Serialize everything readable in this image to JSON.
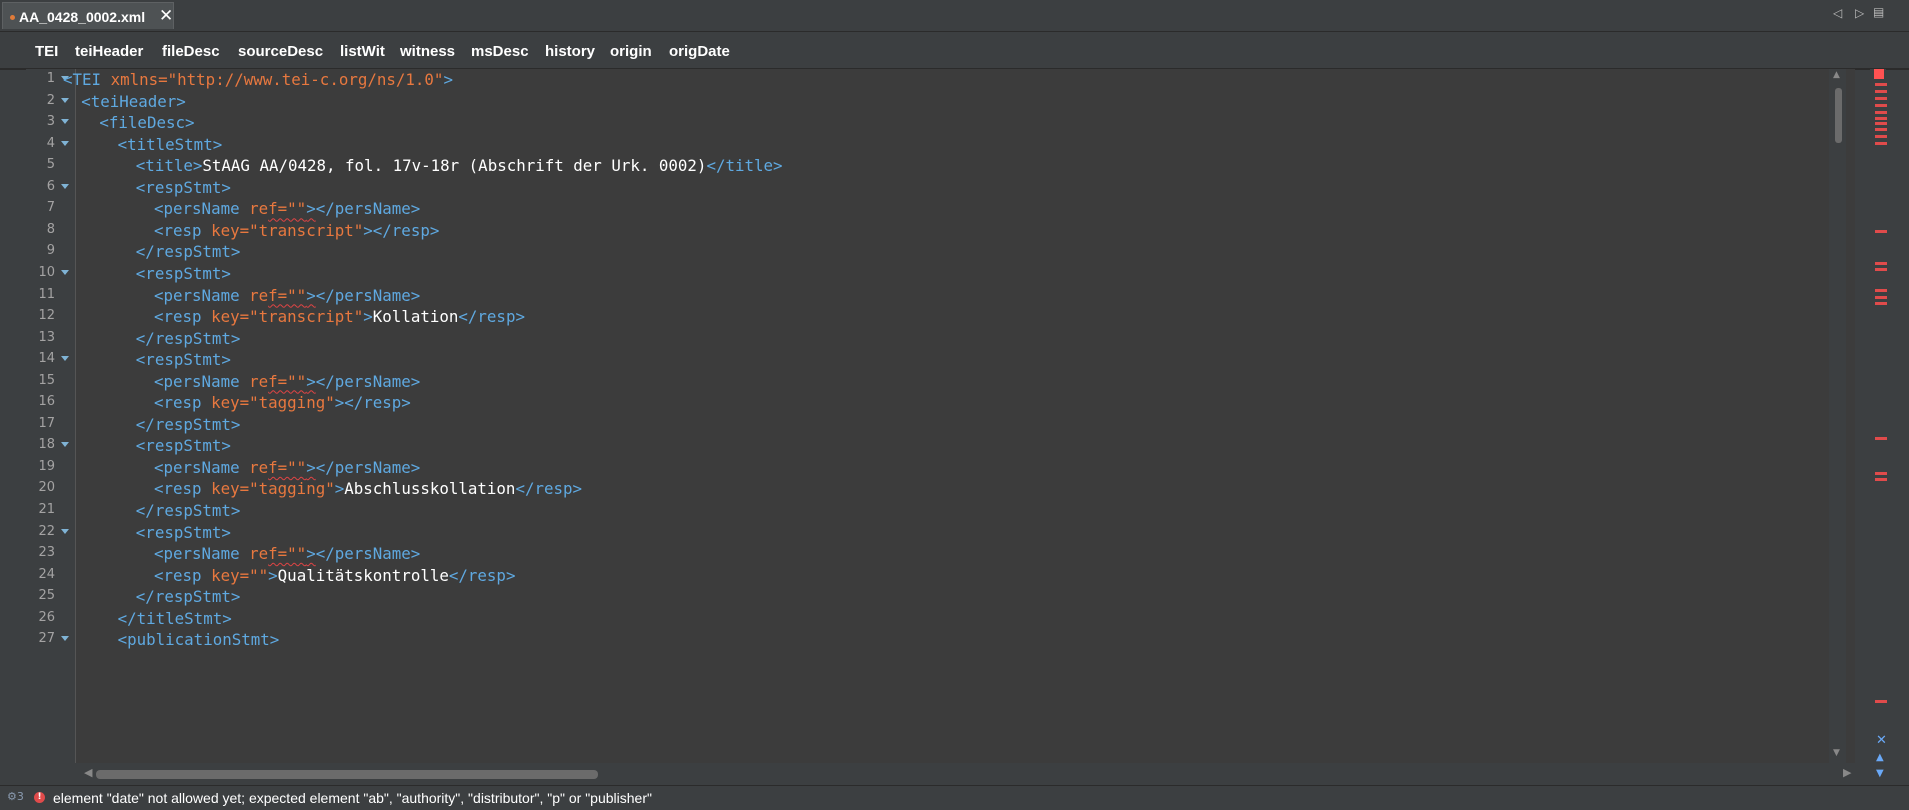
{
  "tab": {
    "title": "AA_0428_0002.xml",
    "close": "✕",
    "modified": true
  },
  "tab_nav": {
    "prev": "◁",
    "next": "▷",
    "menu": "▤"
  },
  "breadcrumb": [
    "TEI",
    "teiHeader",
    "fileDesc",
    "sourceDesc",
    "listWit",
    "witness",
    "msDesc",
    "history",
    "origin",
    "origDate"
  ],
  "editor": {
    "lines": [
      {
        "n": "1",
        "fold": true,
        "indent": 0,
        "tokens": [
          {
            "c": "tag",
            "t": "<TEI "
          },
          {
            "c": "attr",
            "t": "xmlns="
          },
          {
            "c": "val",
            "t": "\"http://www.tei-c.org/ns/1.0\""
          },
          {
            "c": "tag",
            "t": ">"
          }
        ]
      },
      {
        "n": "2",
        "fold": true,
        "indent": 1,
        "tokens": [
          {
            "c": "tag",
            "t": "<teiHeader>"
          }
        ]
      },
      {
        "n": "3",
        "fold": true,
        "indent": 2,
        "tokens": [
          {
            "c": "tag",
            "t": "<fileDesc>"
          }
        ]
      },
      {
        "n": "4",
        "fold": true,
        "indent": 3,
        "tokens": [
          {
            "c": "tag",
            "t": "<titleStmt>"
          }
        ]
      },
      {
        "n": "5",
        "fold": false,
        "indent": 4,
        "tokens": [
          {
            "c": "tag",
            "t": "<title>"
          },
          {
            "c": "text",
            "t": "StAAG AA/0428, fol. 17v-18r (Abschrift der Urk. 0002)"
          },
          {
            "c": "tag",
            "t": "</title>"
          }
        ]
      },
      {
        "n": "6",
        "fold": true,
        "indent": 4,
        "tokens": [
          {
            "c": "tag",
            "t": "<respStmt>"
          }
        ]
      },
      {
        "n": "7",
        "fold": false,
        "indent": 5,
        "tokens": [
          {
            "c": "tag",
            "t": "<persName "
          },
          {
            "c": "attr",
            "t": "re"
          },
          {
            "c": "attr sq",
            "t": "f=\"\""
          },
          {
            "c": "tag sq",
            "t": ">"
          },
          {
            "c": "tag",
            "t": "</persName>"
          }
        ]
      },
      {
        "n": "8",
        "fold": false,
        "indent": 5,
        "tokens": [
          {
            "c": "tag",
            "t": "<resp "
          },
          {
            "c": "attr",
            "t": "key="
          },
          {
            "c": "val",
            "t": "\"transcript\""
          },
          {
            "c": "tag",
            "t": "></resp>"
          }
        ]
      },
      {
        "n": "9",
        "fold": false,
        "indent": 4,
        "tokens": [
          {
            "c": "tag",
            "t": "</respStmt>"
          }
        ]
      },
      {
        "n": "10",
        "fold": true,
        "indent": 4,
        "tokens": [
          {
            "c": "tag",
            "t": "<respStmt>"
          }
        ]
      },
      {
        "n": "11",
        "fold": false,
        "indent": 5,
        "tokens": [
          {
            "c": "tag",
            "t": "<persName "
          },
          {
            "c": "attr",
            "t": "re"
          },
          {
            "c": "attr sq",
            "t": "f=\"\""
          },
          {
            "c": "tag sq",
            "t": ">"
          },
          {
            "c": "tag",
            "t": "</persName>"
          }
        ]
      },
      {
        "n": "12",
        "fold": false,
        "indent": 5,
        "tokens": [
          {
            "c": "tag",
            "t": "<resp "
          },
          {
            "c": "attr",
            "t": "key="
          },
          {
            "c": "val",
            "t": "\"transcript\""
          },
          {
            "c": "tag",
            "t": ">"
          },
          {
            "c": "text",
            "t": "Kollation"
          },
          {
            "c": "tag",
            "t": "</resp>"
          }
        ]
      },
      {
        "n": "13",
        "fold": false,
        "indent": 4,
        "tokens": [
          {
            "c": "tag",
            "t": "</respStmt>"
          }
        ]
      },
      {
        "n": "14",
        "fold": true,
        "indent": 4,
        "tokens": [
          {
            "c": "tag",
            "t": "<respStmt>"
          }
        ]
      },
      {
        "n": "15",
        "fold": false,
        "indent": 5,
        "tokens": [
          {
            "c": "tag",
            "t": "<persName "
          },
          {
            "c": "attr",
            "t": "re"
          },
          {
            "c": "attr sq",
            "t": "f=\"\""
          },
          {
            "c": "tag sq",
            "t": ">"
          },
          {
            "c": "tag",
            "t": "</persName>"
          }
        ]
      },
      {
        "n": "16",
        "fold": false,
        "indent": 5,
        "tokens": [
          {
            "c": "tag",
            "t": "<resp "
          },
          {
            "c": "attr",
            "t": "key="
          },
          {
            "c": "val",
            "t": "\"tagging\""
          },
          {
            "c": "tag",
            "t": "></resp>"
          }
        ]
      },
      {
        "n": "17",
        "fold": false,
        "indent": 4,
        "tokens": [
          {
            "c": "tag",
            "t": "</respStmt>"
          }
        ]
      },
      {
        "n": "18",
        "fold": true,
        "indent": 4,
        "tokens": [
          {
            "c": "tag",
            "t": "<respStmt>"
          }
        ]
      },
      {
        "n": "19",
        "fold": false,
        "indent": 5,
        "tokens": [
          {
            "c": "tag",
            "t": "<persName "
          },
          {
            "c": "attr",
            "t": "re"
          },
          {
            "c": "attr sq",
            "t": "f=\"\""
          },
          {
            "c": "tag sq",
            "t": ">"
          },
          {
            "c": "tag",
            "t": "</persName>"
          }
        ]
      },
      {
        "n": "20",
        "fold": false,
        "indent": 5,
        "tokens": [
          {
            "c": "tag",
            "t": "<resp "
          },
          {
            "c": "attr",
            "t": "key="
          },
          {
            "c": "val",
            "t": "\"tagging\""
          },
          {
            "c": "tag",
            "t": ">"
          },
          {
            "c": "text",
            "t": "Abschlusskollation"
          },
          {
            "c": "tag",
            "t": "</resp>"
          }
        ]
      },
      {
        "n": "21",
        "fold": false,
        "indent": 4,
        "tokens": [
          {
            "c": "tag",
            "t": "</respStmt>"
          }
        ]
      },
      {
        "n": "22",
        "fold": true,
        "indent": 4,
        "tokens": [
          {
            "c": "tag",
            "t": "<respStmt>"
          }
        ]
      },
      {
        "n": "23",
        "fold": false,
        "indent": 5,
        "tokens": [
          {
            "c": "tag",
            "t": "<persName "
          },
          {
            "c": "attr",
            "t": "re"
          },
          {
            "c": "attr sq",
            "t": "f=\"\""
          },
          {
            "c": "tag sq",
            "t": ">"
          },
          {
            "c": "tag",
            "t": "</persName>"
          }
        ]
      },
      {
        "n": "24",
        "fold": false,
        "indent": 5,
        "tokens": [
          {
            "c": "tag",
            "t": "<resp "
          },
          {
            "c": "attr",
            "t": "key="
          },
          {
            "c": "val",
            "t": "\"\""
          },
          {
            "c": "tag",
            "t": ">"
          },
          {
            "c": "text",
            "t": "Qualitätskontrolle"
          },
          {
            "c": "tag",
            "t": "</resp>"
          }
        ]
      },
      {
        "n": "25",
        "fold": false,
        "indent": 4,
        "tokens": [
          {
            "c": "tag",
            "t": "</respStmt>"
          }
        ]
      },
      {
        "n": "26",
        "fold": false,
        "indent": 3,
        "tokens": [
          {
            "c": "tag",
            "t": "</titleStmt>"
          }
        ]
      },
      {
        "n": "27",
        "fold": true,
        "indent": 3,
        "tokens": [
          {
            "c": "tag",
            "t": "<publicationStmt>"
          }
        ]
      }
    ]
  },
  "error_stripe_marks": 14,
  "status": {
    "icon": "⚙3",
    "error_icon": "!",
    "message": "element \"date\" not allowed yet; expected element \"ab\", \"authority\", \"distributor\", \"p\" or \"publisher\""
  },
  "colors": {
    "background": "#3c3f41",
    "editor_bg": "#3c3c3c",
    "tag": "#5fa9e1",
    "attribute": "#e8783f",
    "text": "#ffffff",
    "error": "#e04b4b"
  }
}
